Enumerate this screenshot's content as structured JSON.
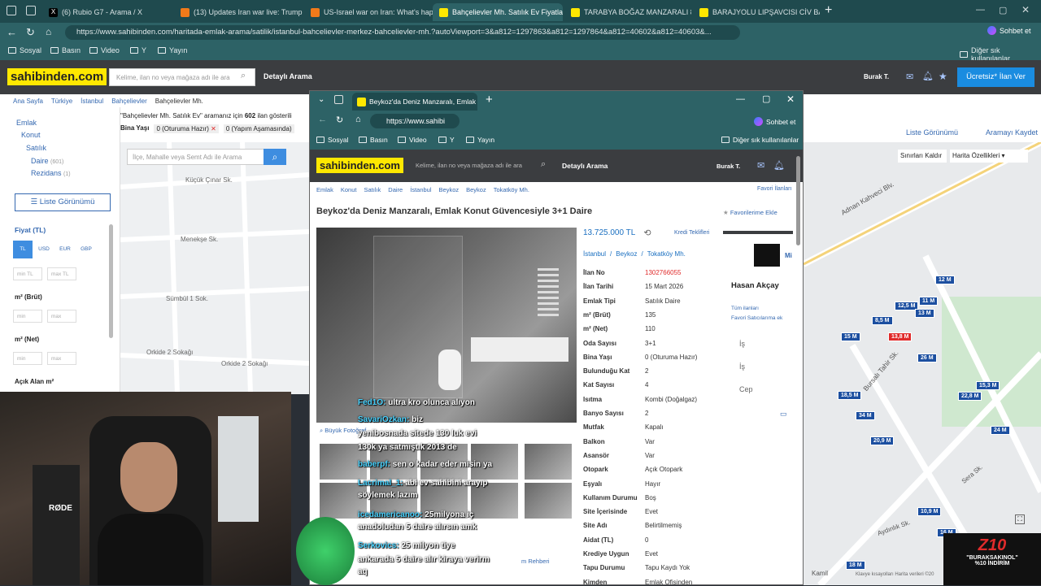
{
  "browser": {
    "tabs": [
      {
        "label": "(6) Rubio G7 - Arama / X",
        "color": "#000000"
      },
      {
        "label": "(13) Updates Iran war live: Trump",
        "color": "#f07a1a"
      },
      {
        "label": "US-Israel war on Iran: What's happ",
        "color": "#f07a1a"
      },
      {
        "label": "Bahçelievler Mh. Satılık Ev Fiyatları",
        "color": "#ffe800"
      },
      {
        "label": "TARABYA BOĞAZ MANZARALI 80",
        "color": "#ffe800"
      },
      {
        "label": "BARAJYOLU LIPŞAVCISI CİV BAHÇ",
        "color": "#ffe800"
      }
    ],
    "url": "https://www.sahibinden.com/haritada-emlak-arama/satilik/istanbul-bahcelievler-merkez-bahcelievler-mh.?autoViewport=3&a812=1297863&a812=1297864&a812=40602&a812=40603&...",
    "bookmarks": [
      "Sosyal",
      "Basın",
      "Video",
      "Y",
      "Yayın"
    ],
    "other_bookmarks": "Diğer sık kullanılanlar",
    "chat_button": "Sohbet et",
    "profile": "Burak T."
  },
  "site": {
    "logo": "sahibinden.com",
    "search_placeholder": "Kelime, ilan no veya mağaza adı ile ara",
    "detailed_search": "Detaylı Arama",
    "post_ad": "Ücretsiz* İlan Ver",
    "crumbs": [
      "Ana Sayfa",
      "Türkiye",
      "İstanbul",
      "Bahçelievler",
      "Bahçelievler Mh."
    ],
    "result_prefix": "\"Bahçelievler Mh. Satılık Ev\" aramanız için",
    "result_count": "602",
    "result_suffix": "ilan gösterili",
    "building_age_label": "Bina Yaşı",
    "filter_chip_1": "0 (Oturuma Hazır)",
    "filter_chip_2": "0 (Yapım Aşamasında)",
    "left_menu": {
      "emlak": "Emlak",
      "konut": "Konut",
      "satilik": "Satılık",
      "daire": "Daire",
      "daire_count": "(601)",
      "rezidans": "Rezidans",
      "rezidans_count": "(1)"
    },
    "list_view": "Liste Görünümü",
    "price_label": "Fiyat (TL)",
    "currencies": [
      "TL",
      "USD",
      "EUR",
      "GBP"
    ],
    "min_tl": "min TL",
    "max_tl": "max TL",
    "m2_brut": "m² (Brüt)",
    "m2_net": "m² (Net)",
    "min": "min",
    "max": "max",
    "open_area": "Açık Alan m²",
    "map_search_placeholder": "İlçe, Mahalle veya Semt  Adı ile Arama",
    "save_search": "Aramayı Kaydet",
    "borders": "Sınırları Kaldır",
    "map_features": "Harita Özellikleri",
    "street_labels_left": [
      "Küçük Çınar Sk.",
      "Menekşe Sk.",
      "Sümbül 1 Sok.",
      "Orkide 2 Sokağı",
      "Orkide 2 Sokağı"
    ],
    "street_labels_right": [
      "Adnan Kahveci Blv.",
      "Bursalı Tahir Sk.",
      "Sera Sk.",
      "Aydınlık Sk.",
      "Kamil"
    ],
    "map_markers": [
      {
        "label": "12 M",
        "red": false
      },
      {
        "label": "11 M",
        "red": false
      },
      {
        "label": "12,5 M",
        "red": false
      },
      {
        "label": "13 M",
        "red": false
      },
      {
        "label": "8,5 M",
        "red": false
      },
      {
        "label": "15 M",
        "red": false
      },
      {
        "label": "13,8 M",
        "red": true
      },
      {
        "label": "26 M",
        "red": false
      },
      {
        "label": "15,3 M",
        "red": false
      },
      {
        "label": "18,5 M",
        "red": false
      },
      {
        "label": "22,8 M",
        "red": false
      },
      {
        "label": "34 M",
        "red": false
      },
      {
        "label": "20,9 M",
        "red": false
      },
      {
        "label": "24 M",
        "red": false
      },
      {
        "label": "10,9 M",
        "red": false
      },
      {
        "label": "18 M",
        "red": false
      },
      {
        "label": "16 M",
        "red": false
      }
    ],
    "map_footer": "Klavye kısayolları   Harita verileri ©20"
  },
  "popup": {
    "tab_title": "Beykoz'da Deniz Manzaralı, Emlak",
    "url": "https://www.sahibi",
    "bookmarks": [
      "Sosyal",
      "Basın",
      "Video",
      "Y",
      "Yayın"
    ],
    "other_bookmarks": "Diğer sık kullanılanlar",
    "chat_button": "Sohbet et",
    "profile": "Burak T.",
    "logo": "sahibinden.com",
    "search_placeholder": "Kelime, ilan no veya mağaza adı ile ara",
    "detailed_search": "Detaylı Arama",
    "crumbs": [
      "Emlak",
      "Konut",
      "Satılık",
      "Daire",
      "İstanbul",
      "Beykoz",
      "Beykoz",
      "Tokatköy Mh."
    ],
    "favorites_link": "Favori İlanları",
    "title": "Beykoz'da Deniz Manzaralı, Emlak Konut Güvencesiyle 3+1 Daire",
    "add_fav": "Favorilerime Ekle",
    "price": "13.725.000 TL",
    "credit": "Kredi Teklifleri",
    "location": [
      "İstanbul",
      "Beykoz",
      "Tokatköy Mh."
    ],
    "big_photo": "Büyük Fotoğraf",
    "attributes": [
      {
        "k": "İlan No",
        "v": "1302766055",
        "red": true
      },
      {
        "k": "İlan Tarihi",
        "v": "15 Mart 2026"
      },
      {
        "k": "Emlak Tipi",
        "v": "Satılık Daire"
      },
      {
        "k": "m² (Brüt)",
        "v": "135"
      },
      {
        "k": "m² (Net)",
        "v": "110"
      },
      {
        "k": "Oda Sayısı",
        "v": "3+1"
      },
      {
        "k": "Bina Yaşı",
        "v": "0 (Oturuma Hazır)"
      },
      {
        "k": "Bulunduğu Kat",
        "v": "2"
      },
      {
        "k": "Kat Sayısı",
        "v": "4"
      },
      {
        "k": "Isıtma",
        "v": "Kombi (Doğalgaz)"
      },
      {
        "k": "Banyo Sayısı",
        "v": "2"
      },
      {
        "k": "Mutfak",
        "v": "Kapalı"
      },
      {
        "k": "Balkon",
        "v": "Var"
      },
      {
        "k": "Asansör",
        "v": "Var"
      },
      {
        "k": "Otopark",
        "v": "Açık Otopark"
      },
      {
        "k": "Eşyalı",
        "v": "Hayır"
      },
      {
        "k": "Kullanım Durumu",
        "v": "Boş"
      },
      {
        "k": "Site İçerisinde",
        "v": "Evet"
      },
      {
        "k": "Site Adı",
        "v": "Belirtilmemiş"
      },
      {
        "k": "Aidat (TL)",
        "v": "0"
      },
      {
        "k": "Krediye Uygun",
        "v": "Evet"
      },
      {
        "k": "Tapu Durumu",
        "v": "Tapu Kaydı Yok"
      },
      {
        "k": "Kimden",
        "v": "Emlak Ofisinden"
      }
    ],
    "seller_name": "Hasan Akçay",
    "seller_links": [
      "Tüm ilanları",
      "Favori Satıcılarıma ek"
    ],
    "contact": [
      "İş",
      "İş",
      "Cep"
    ],
    "seller_logo_text": "Mi",
    "help_text": "m Rehberi"
  },
  "stream": {
    "chat": [
      {
        "user": "Fed1O:",
        "msg": "ultra kro olunca alıyon"
      },
      {
        "user": "SavariOzkan:",
        "msg": "biz"
      },
      {
        "user": "",
        "msg": "yenibosnada sitede 130 luk evi"
      },
      {
        "user": "",
        "msg": "130k ya satmıştık 2013 de"
      },
      {
        "user": "baberpf:",
        "msg": "sen o kadar eder misin ya"
      },
      {
        "user": "Lacrimal_1:",
        "msg": "abi ev sahibini arayıp"
      },
      {
        "user": "",
        "msg": "söylemek lazım"
      },
      {
        "user": "icedamericanoo:",
        "msg": "25milyona iç"
      },
      {
        "user": "",
        "msg": "anadoludan 5 daire alırsın amk"
      },
      {
        "user": "Serkovics:",
        "msg": "25 milyon tiye"
      },
      {
        "user": "",
        "msg": "ankarada 5 daire alır kiraya verirm"
      },
      {
        "user": "",
        "msg": "aq"
      }
    ],
    "mic_brand": "RØDE",
    "promo_title": "Z10",
    "promo_code": "\"BURAKSAKINOL\"",
    "promo_discount": "%10 İNDİRİM"
  }
}
